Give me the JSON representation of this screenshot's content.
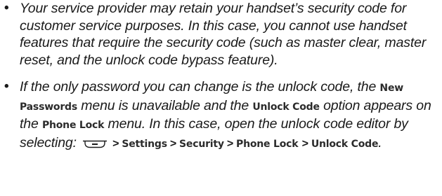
{
  "bullet_symbol": "•",
  "items": [
    {
      "text": "Your service provider may retain your handset’s security code for customer service purposes. In this case, you cannot use handset features that require the security code (such as master clear, master reset, and the unlock code bypass feature)."
    },
    {
      "part1": "If the only password you can change is the unlock code, the ",
      "term_new_passwords": "New Passwords",
      "part2": " menu is unavailable and the ",
      "term_unlock_code": "Unlock Code",
      "part3": " option appears on the ",
      "term_phone_lock": "Phone Lock",
      "part4": " menu. In this case, open the unlock code editor by selecting: ",
      "menu_key_icon": "menu-key-icon",
      "path": [
        "Settings",
        "Security",
        "Phone Lock",
        "Unlock Code"
      ],
      "separator": ">",
      "end": "."
    }
  ]
}
